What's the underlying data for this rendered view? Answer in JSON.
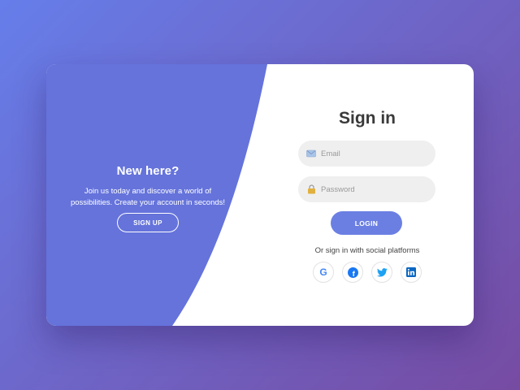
{
  "left": {
    "title": "New here?",
    "text": "Join us today and discover a world of possibilities. Create your account in seconds!",
    "signup_label": "SIGN UP"
  },
  "right": {
    "title": "Sign in",
    "email_placeholder": "Email",
    "password_placeholder": "Password",
    "login_label": "LOGIN",
    "social_text": "Or sign in with social platforms",
    "social": [
      {
        "icon": "google-icon",
        "color": "#4285F4"
      },
      {
        "icon": "facebook-icon",
        "color": "#1877F2"
      },
      {
        "icon": "twitter-icon",
        "color": "#1DA1F2"
      },
      {
        "icon": "linkedin-icon",
        "color": "#0A66C2"
      }
    ]
  },
  "colors": {
    "background_start": "#667eea",
    "background_end": "#764ba2",
    "panel": "#6573db",
    "accent": "#6b7fe3"
  }
}
